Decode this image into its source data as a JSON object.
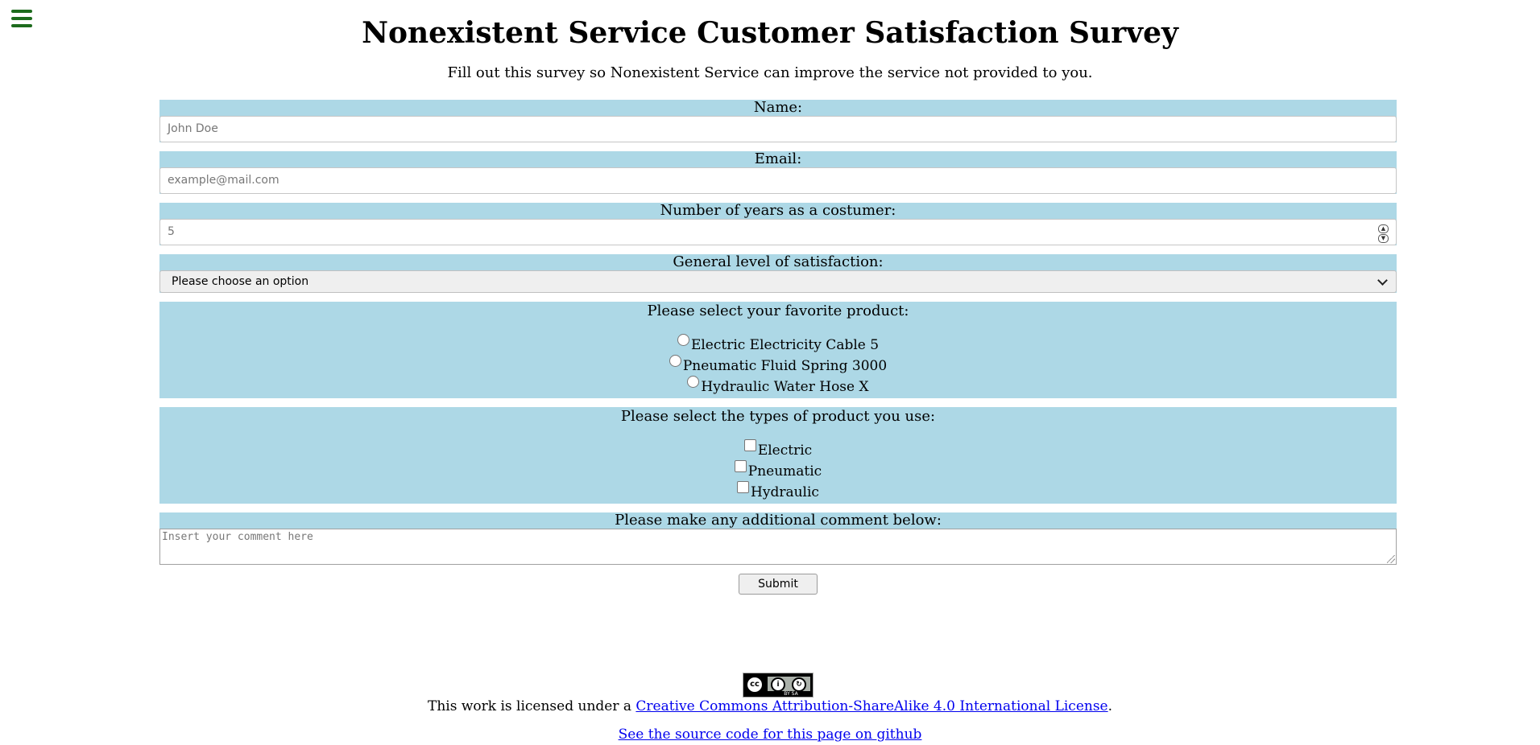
{
  "menu": {
    "icon": "hamburger-menu-icon",
    "color": "#1d6b1d"
  },
  "header": {
    "title": "Nonexistent Service Customer Satisfaction Survey",
    "subtitle": "Fill out this survey so Nonexistent Service can improve the service not provided to you."
  },
  "form": {
    "group_color": "#add8e6",
    "name": {
      "label": "Name:",
      "placeholder": "John Doe"
    },
    "email": {
      "label": "Email:",
      "placeholder": "example@mail.com"
    },
    "years": {
      "label": "Number of years as a costumer:",
      "placeholder": "5"
    },
    "satisfaction": {
      "label": "General level of satisfaction:",
      "selected": "Please choose an option"
    },
    "favorite": {
      "label": "Please select your favorite product:",
      "options": [
        "Electric Electricity Cable 5",
        "Pneumatic Fluid Spring 3000",
        "Hydraulic Water Hose X"
      ]
    },
    "types": {
      "label": "Please select the types of product you use:",
      "options": [
        "Electric",
        "Pneumatic",
        "Hydraulic"
      ]
    },
    "comment": {
      "label": "Please make any additional comment below:",
      "placeholder": "Insert your comment here"
    },
    "submit_label": "Submit"
  },
  "footer": {
    "badge_text": "BY SA",
    "license_prefix": "This work is licensed under a ",
    "license_link": "Creative Commons Attribution-ShareAlike 4.0 International License",
    "license_suffix": ".",
    "source_link": "See the source code for this page on github"
  }
}
